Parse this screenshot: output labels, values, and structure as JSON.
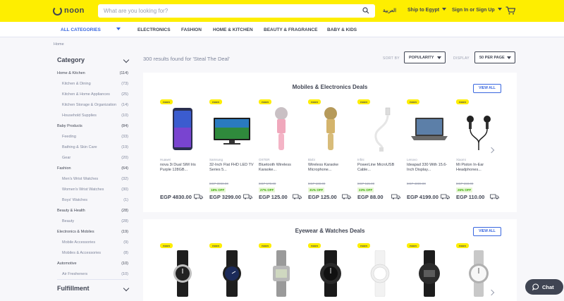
{
  "header": {
    "logo_text": "noon",
    "search_placeholder": "What are you looking for?",
    "language": "العربية",
    "ship_to": "Ship to Egypt",
    "sign_in": "Sign In or Sign Up",
    "brand_color": "#feee00",
    "icons": [
      "search-icon",
      "cart-icon",
      "chevron-down-icon"
    ]
  },
  "nav": {
    "all_categories": "ALL CATEGORIES",
    "items": [
      "ELECTRONICS",
      "FASHION",
      "HOME & KITCHEN",
      "BEAUTY & FRAGRANCE",
      "BABY & KIDS"
    ]
  },
  "breadcrumb": "Home",
  "sidebar": {
    "category_heading": "Category",
    "fulfillment_heading": "Fulfillment",
    "items": [
      {
        "label": "Home & Kitchen",
        "count": "(114)",
        "sub": false
      },
      {
        "label": "Kitchen & Dining",
        "count": "(73)",
        "sub": true
      },
      {
        "label": "Kitchen & Home Appliances",
        "count": "(25)",
        "sub": true
      },
      {
        "label": "Kitchen Storage & Organization",
        "count": "(14)",
        "sub": true
      },
      {
        "label": "Household Supplies",
        "count": "(10)",
        "sub": true
      },
      {
        "label": "Baby Products",
        "count": "(84)",
        "sub": false
      },
      {
        "label": "Feeding",
        "count": "(33)",
        "sub": true
      },
      {
        "label": "Bathing & Skin Care",
        "count": "(19)",
        "sub": true
      },
      {
        "label": "Gear",
        "count": "(20)",
        "sub": true
      },
      {
        "label": "Fashion",
        "count": "(64)",
        "sub": false
      },
      {
        "label": "Men's Wrist Watches",
        "count": "(32)",
        "sub": true
      },
      {
        "label": "Women's Wrist Watches",
        "count": "(30)",
        "sub": true
      },
      {
        "label": "Boys' Watches",
        "count": "(1)",
        "sub": true
      },
      {
        "label": "Beauty & Health",
        "count": "(28)",
        "sub": false
      },
      {
        "label": "Beauty",
        "count": "(28)",
        "sub": true
      },
      {
        "label": "Electronics & Mobiles",
        "count": "(19)",
        "sub": false
      },
      {
        "label": "Mobile Accessories",
        "count": "(9)",
        "sub": true
      },
      {
        "label": "Mobiles & Accessories",
        "count": "(8)",
        "sub": true
      },
      {
        "label": "Automotive",
        "count": "(10)",
        "sub": false
      },
      {
        "label": "Air Fresheners",
        "count": "(10)",
        "sub": true
      }
    ]
  },
  "results": {
    "summary": "300 results found for 'Steal The Deal'",
    "sort_label": "SORT BY",
    "sort_value": "POPULARITY",
    "display_label": "DISPLAY",
    "display_value": "50 PER PAGE"
  },
  "sections": [
    {
      "title": "Mobiles & Electronics Deals",
      "view_all": "VIEW ALL",
      "products": [
        {
          "badge": "noon",
          "brand": "Huawei",
          "name": "nova 3i Dual SIM Iris Purple 128GB...",
          "old_price": "",
          "discount": "",
          "price": "EGP 4830.00",
          "image": "phone"
        },
        {
          "badge": "noon",
          "brand": "Samsung",
          "name": "32-Inch Flat FHD LED TV Series 5...",
          "old_price": "EGP 3990.00",
          "discount": "18% OFF",
          "price": "EGP 3299.00",
          "image": "tv"
        },
        {
          "badge": "noon",
          "brand": "OXTER",
          "name": "Bluetooth Wireless Karaoke...",
          "old_price": "EGP 170.00",
          "discount": "27% OFF",
          "price": "EGP 125.00",
          "image": "mic-pink"
        },
        {
          "badge": "noon",
          "brand": "Bixbi",
          "name": "Wireless Karaoke Microphone...",
          "old_price": "EGP 180.00",
          "discount": "31% OFF",
          "price": "EGP 125.00",
          "image": "mic-gold"
        },
        {
          "badge": "noon",
          "brand": "Infini",
          "name": "PowerLine MicroUSB Cable...",
          "old_price": "EGP 115.00",
          "discount": "23% OFF",
          "price": "EGP 88.00",
          "image": "cable"
        },
        {
          "badge": "noon",
          "brand": "Lenovo",
          "name": "Ideapad 330 With 15.6-Inch Display...",
          "old_price": "EGP 4899.00",
          "discount": "",
          "price": "EGP 4199.00",
          "image": "laptop"
        },
        {
          "badge": "noon",
          "brand": "Xiaomi",
          "name": "Mi Piston In-Ear Headphones...",
          "old_price": "EGP 150.00",
          "discount": "26% OFF",
          "price": "EGP 110.00",
          "image": "earphones"
        }
      ]
    },
    {
      "title": "Eyewear & Watches Deals",
      "view_all": "VIEW ALL",
      "products": [
        {
          "badge": "noon",
          "image": "watch-black-leather"
        },
        {
          "badge": "noon",
          "image": "watch-black-navy"
        },
        {
          "badge": "noon",
          "image": "watch-digital-silver"
        },
        {
          "badge": "noon",
          "image": "watch-black-sport"
        },
        {
          "badge": "noon",
          "image": "watch-white"
        },
        {
          "badge": "noon",
          "image": "watch-black-digital"
        },
        {
          "badge": "noon",
          "image": "watch-silver-mesh"
        }
      ]
    }
  ],
  "chat": {
    "label": "Chat"
  }
}
